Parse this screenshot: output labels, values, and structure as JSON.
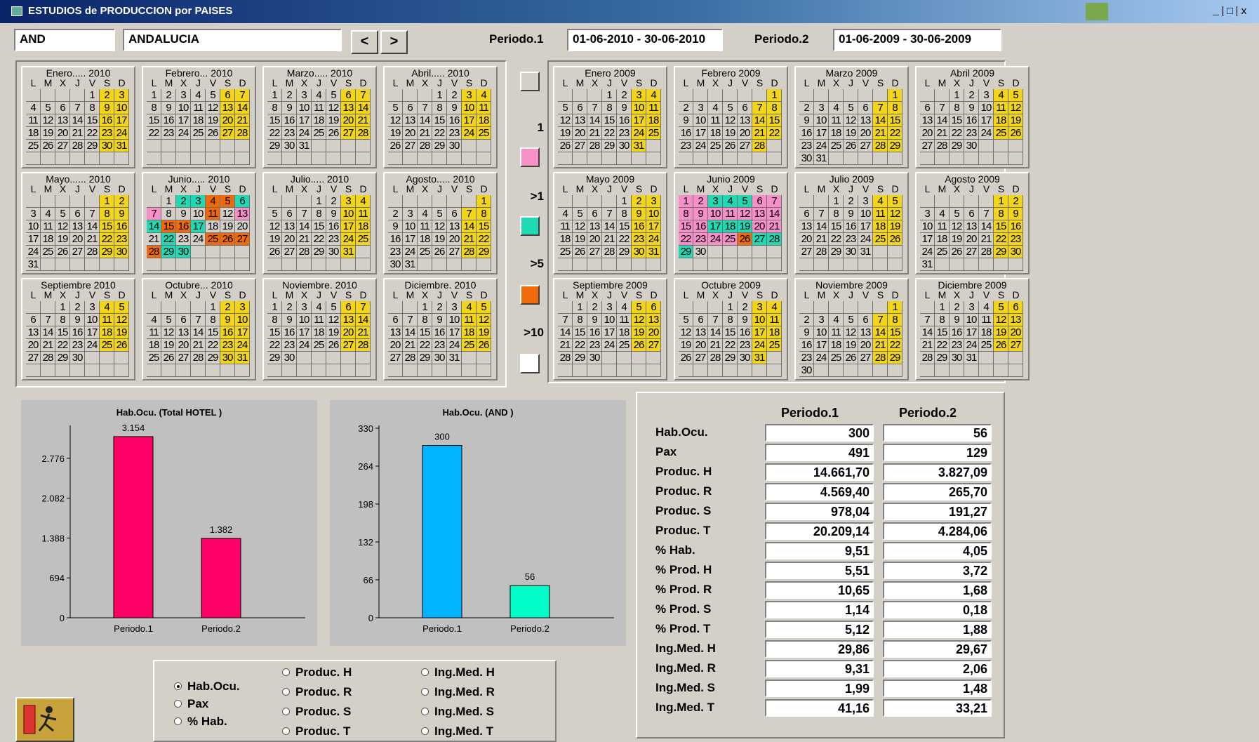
{
  "window": {
    "title": "ESTUDIOS de PRODUCCION por PAISES",
    "controls": "_|□|x"
  },
  "toolbar": {
    "code": "AND",
    "region": "ANDALUCIA",
    "prev_label": "<",
    "next_label": ">",
    "periodo1_label": "Periodo.1",
    "periodo1_value": "01-06-2010 - 30-06-2010",
    "periodo2_label": "Periodo.2",
    "periodo2_value": "01-06-2009 - 30-06-2009"
  },
  "weekday_headers": [
    "L",
    "M",
    "X",
    "J",
    "V",
    "S",
    "D"
  ],
  "legend": {
    "items": [
      {
        "label": "",
        "color": "#d4d0c8"
      },
      {
        "label": "1",
        "color": "#f78fc8"
      },
      {
        "label": ">1",
        "color": "#1fd9b5"
      },
      {
        "label": ">5",
        "color": "#f06a0a"
      },
      {
        "label": ">10",
        "color": "#ffffff"
      }
    ]
  },
  "calendars_left": [
    {
      "title": "Enero..... 2010",
      "offset": 4,
      "days": 31,
      "h": {
        "2": "y",
        "3": "y",
        "9": "y",
        "10": "y",
        "16": "y",
        "17": "y",
        "23": "y",
        "24": "y",
        "30": "y",
        "31": "y"
      }
    },
    {
      "title": "Febrero... 2010",
      "offset": 0,
      "days": 28,
      "h": {
        "6": "y",
        "7": "y",
        "13": "y",
        "14": "y",
        "20": "y",
        "21": "y",
        "27": "y",
        "28": "y"
      }
    },
    {
      "title": "Marzo..... 2010",
      "offset": 0,
      "days": 31,
      "h": {
        "6": "y",
        "7": "y",
        "13": "y",
        "14": "y",
        "20": "y",
        "21": "y",
        "27": "y",
        "28": "y"
      }
    },
    {
      "title": "Abril..... 2010",
      "offset": 3,
      "days": 30,
      "h": {
        "3": "y",
        "4": "y",
        "10": "y",
        "11": "y",
        "17": "y",
        "18": "y",
        "24": "y",
        "25": "y"
      }
    },
    {
      "title": "Mayo...... 2010",
      "offset": 5,
      "days": 31,
      "h": {
        "1": "y",
        "2": "y",
        "8": "y",
        "9": "y",
        "15": "y",
        "16": "y",
        "22": "y",
        "23": "y",
        "29": "y",
        "30": "y"
      }
    },
    {
      "title": "Junio..... 2010",
      "offset": 1,
      "days": 30,
      "h": {
        "2": "t",
        "3": "t",
        "4": "o",
        "5": "o",
        "6": "t",
        "7": "p",
        "11": "o",
        "13": "p",
        "14": "t",
        "15": "o",
        "16": "o",
        "17": "t",
        "22": "t",
        "25": "o",
        "26": "o",
        "27": "o",
        "28": "o",
        "29": "t",
        "30": "t"
      }
    },
    {
      "title": "Julio..... 2010",
      "offset": 3,
      "days": 31,
      "h": {
        "3": "y",
        "4": "y",
        "10": "y",
        "11": "y",
        "17": "y",
        "18": "y",
        "24": "y",
        "25": "y",
        "31": "y"
      }
    },
    {
      "title": "Agosto..... 2010",
      "offset": 6,
      "days": 31,
      "h": {
        "1": "y",
        "7": "y",
        "8": "y",
        "14": "y",
        "15": "y",
        "21": "y",
        "22": "y",
        "28": "y",
        "29": "y"
      }
    },
    {
      "title": "Septiembre 2010",
      "offset": 2,
      "days": 30,
      "h": {
        "4": "y",
        "5": "y",
        "11": "y",
        "12": "y",
        "18": "y",
        "19": "y",
        "25": "y",
        "26": "y"
      }
    },
    {
      "title": "Octubre... 2010",
      "offset": 4,
      "days": 31,
      "h": {
        "2": "y",
        "3": "y",
        "9": "y",
        "10": "y",
        "16": "y",
        "17": "y",
        "23": "y",
        "24": "y",
        "30": "y",
        "31": "y"
      }
    },
    {
      "title": "Noviembre. 2010",
      "offset": 0,
      "days": 30,
      "h": {
        "6": "y",
        "7": "y",
        "13": "y",
        "14": "y",
        "20": "y",
        "21": "y",
        "27": "y",
        "28": "y"
      }
    },
    {
      "title": "Diciembre. 2010",
      "offset": 2,
      "days": 31,
      "h": {
        "4": "y",
        "5": "y",
        "11": "y",
        "12": "y",
        "18": "y",
        "19": "y",
        "25": "y",
        "26": "y"
      }
    }
  ],
  "calendars_right": [
    {
      "title": "Enero 2009",
      "offset": 3,
      "days": 31,
      "h": {
        "3": "y",
        "4": "y",
        "10": "y",
        "11": "y",
        "17": "y",
        "18": "y",
        "24": "y",
        "25": "y",
        "31": "y"
      }
    },
    {
      "title": "Febrero 2009",
      "offset": 6,
      "days": 28,
      "h": {
        "1": "y",
        "7": "y",
        "8": "y",
        "14": "y",
        "15": "y",
        "21": "y",
        "22": "y",
        "28": "y"
      }
    },
    {
      "title": "Marzo 2009",
      "offset": 6,
      "days": 31,
      "h": {
        "1": "y",
        "7": "y",
        "8": "y",
        "14": "y",
        "15": "y",
        "21": "y",
        "22": "y",
        "28": "y",
        "29": "y"
      }
    },
    {
      "title": "Abril 2009",
      "offset": 2,
      "days": 30,
      "h": {
        "4": "y",
        "5": "y",
        "11": "y",
        "12": "y",
        "18": "y",
        "19": "y",
        "25": "y",
        "26": "y"
      }
    },
    {
      "title": "Mayo 2009",
      "offset": 4,
      "days": 31,
      "h": {
        "2": "y",
        "3": "y",
        "9": "y",
        "10": "y",
        "16": "y",
        "17": "y",
        "23": "y",
        "24": "y",
        "30": "y",
        "31": "y"
      }
    },
    {
      "title": "Junio 2009",
      "offset": 0,
      "days": 30,
      "h": {
        "1": "p",
        "2": "p",
        "3": "t",
        "4": "t",
        "5": "t",
        "6": "p",
        "7": "p",
        "8": "p",
        "9": "p",
        "10": "p",
        "11": "p",
        "12": "p",
        "13": "p",
        "14": "p",
        "15": "p",
        "16": "p",
        "17": "t",
        "18": "t",
        "19": "t",
        "20": "p",
        "21": "p",
        "22": "p",
        "23": "p",
        "24": "p",
        "25": "p",
        "26": "o",
        "27": "t",
        "28": "t",
        "29": "t"
      }
    },
    {
      "title": "Julio 2009",
      "offset": 2,
      "days": 31,
      "h": {
        "4": "y",
        "5": "y",
        "11": "y",
        "12": "y",
        "18": "y",
        "19": "y",
        "25": "y",
        "26": "y"
      }
    },
    {
      "title": "Agosto 2009",
      "offset": 5,
      "days": 31,
      "h": {
        "1": "y",
        "2": "y",
        "8": "y",
        "9": "y",
        "15": "y",
        "16": "y",
        "22": "y",
        "23": "y",
        "29": "y",
        "30": "y"
      }
    },
    {
      "title": "Septiembre 2009",
      "offset": 1,
      "days": 30,
      "h": {
        "5": "y",
        "6": "y",
        "12": "y",
        "13": "y",
        "19": "y",
        "20": "y",
        "26": "y",
        "27": "y"
      }
    },
    {
      "title": "Octubre 2009",
      "offset": 3,
      "days": 31,
      "h": {
        "3": "y",
        "4": "y",
        "10": "y",
        "11": "y",
        "17": "y",
        "18": "y",
        "24": "y",
        "25": "y",
        "31": "y"
      }
    },
    {
      "title": "Noviembre 2009",
      "offset": 6,
      "days": 30,
      "h": {
        "1": "y",
        "7": "y",
        "8": "y",
        "14": "y",
        "15": "y",
        "21": "y",
        "22": "y",
        "28": "y",
        "29": "y"
      }
    },
    {
      "title": "Diciembre 2009",
      "offset": 1,
      "days": 31,
      "h": {
        "5": "y",
        "6": "y",
        "12": "y",
        "13": "y",
        "19": "y",
        "20": "y",
        "26": "y",
        "27": "y"
      }
    }
  ],
  "chart_data": [
    {
      "type": "bar",
      "title": "Hab.Ocu.  (Total HOTEL   )",
      "categories": [
        "Periodo.1",
        "Periodo.2"
      ],
      "values": [
        3154,
        1382
      ],
      "value_labels": [
        "3.154",
        "1.382"
      ],
      "yticks": [
        "0",
        "694",
        "1.388",
        "2.082",
        "2.776"
      ],
      "ytick_values": [
        0,
        694,
        1388,
        2082,
        2776
      ],
      "ylim": [
        0,
        3300
      ],
      "colors": [
        "#ff0066",
        "#ff0066"
      ]
    },
    {
      "type": "bar",
      "title": "Hab.Ocu.  (AND            )",
      "categories": [
        "Periodo.1",
        "Periodo.2"
      ],
      "values": [
        300,
        56
      ],
      "value_labels": [
        "300",
        "56"
      ],
      "yticks": [
        "0",
        "66",
        "132",
        "198",
        "264",
        "330"
      ],
      "ytick_values": [
        0,
        66,
        132,
        198,
        264,
        330
      ],
      "ylim": [
        0,
        330
      ],
      "colors": [
        "#00b4ff",
        "#00ffc8"
      ]
    }
  ],
  "stats": {
    "headers": [
      "Periodo.1",
      "Periodo.2"
    ],
    "rows": [
      {
        "label": "Hab.Ocu.",
        "p1": "300",
        "p2": "56"
      },
      {
        "label": "Pax",
        "p1": "491",
        "p2": "129"
      },
      {
        "label": "Produc. H",
        "p1": "14.661,70",
        "p2": "3.827,09"
      },
      {
        "label": "Produc. R",
        "p1": "4.569,40",
        "p2": "265,70"
      },
      {
        "label": "Produc. S",
        "p1": "978,04",
        "p2": "191,27"
      },
      {
        "label": "Produc. T",
        "p1": "20.209,14",
        "p2": "4.284,06"
      },
      {
        "label": "% Hab.",
        "p1": "9,51",
        "p2": "4,05"
      },
      {
        "label": "% Prod. H",
        "p1": "5,51",
        "p2": "3,72"
      },
      {
        "label": "% Prod. R",
        "p1": "10,65",
        "p2": "1,68"
      },
      {
        "label": "% Prod. S",
        "p1": "1,14",
        "p2": "0,18"
      },
      {
        "label": "% Prod. T",
        "p1": "5,12",
        "p2": "1,88"
      },
      {
        "label": "Ing.Med. H",
        "p1": "29,86",
        "p2": "29,67"
      },
      {
        "label": "Ing.Med. R",
        "p1": "9,31",
        "p2": "2,06"
      },
      {
        "label": "Ing.Med. S",
        "p1": "1,99",
        "p2": "1,48"
      },
      {
        "label": "Ing.Med. T",
        "p1": "41,16",
        "p2": "33,21"
      }
    ]
  },
  "options": {
    "col1": [
      {
        "label": "Hab.Ocu.",
        "selected": true
      },
      {
        "label": "Pax",
        "selected": false
      },
      {
        "label": "% Hab.",
        "selected": false
      }
    ],
    "col2": [
      {
        "label": "Produc. H",
        "selected": false
      },
      {
        "label": "Produc. R",
        "selected": false
      },
      {
        "label": "Produc. S",
        "selected": false
      },
      {
        "label": "Produc. T",
        "selected": false
      }
    ],
    "col3": [
      {
        "label": "Ing.Med. H",
        "selected": false
      },
      {
        "label": "Ing.Med. R",
        "selected": false
      },
      {
        "label": "Ing.Med. S",
        "selected": false
      },
      {
        "label": "Ing.Med. T",
        "selected": false
      }
    ]
  },
  "exit_icon": "exit-runner-icon"
}
